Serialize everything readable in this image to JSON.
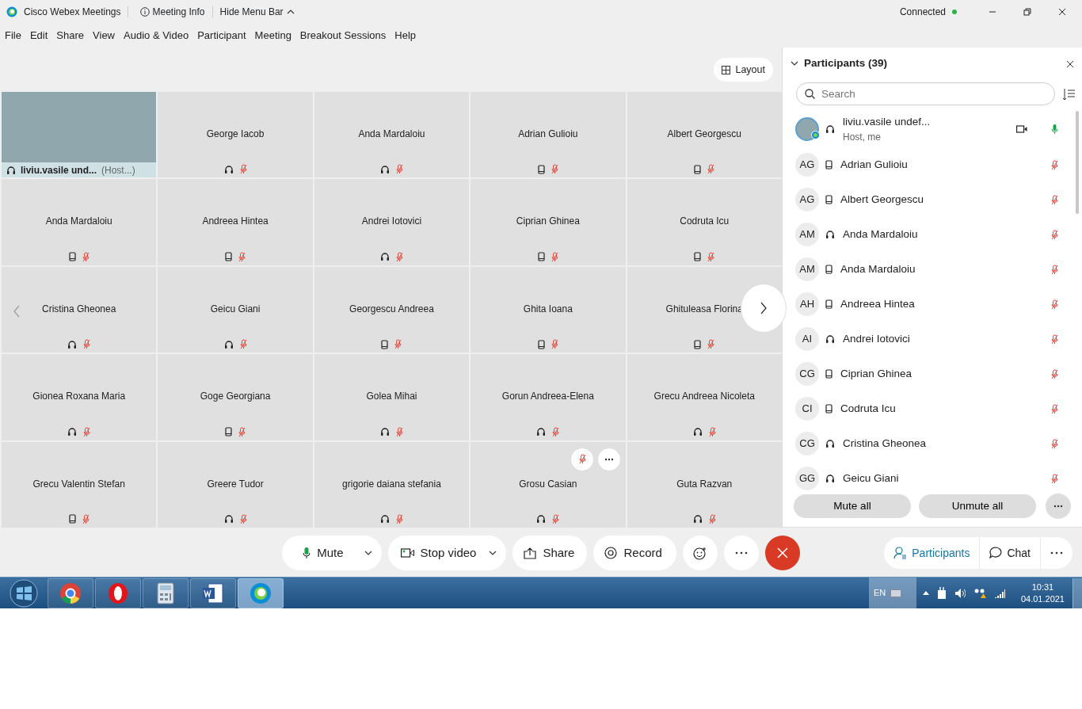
{
  "window": {
    "title": "Cisco Webex Meetings",
    "meeting_info": "Meeting Info",
    "hide_menu": "Hide Menu Bar",
    "status": "Connected"
  },
  "menu": [
    "File",
    "Edit",
    "Share",
    "View",
    "Audio & Video",
    "Participant",
    "Meeting",
    "Breakout Sessions",
    "Help"
  ],
  "layout_button": "Layout",
  "self_view": {
    "name": "liviu.vasile und...",
    "role": "(Host...)"
  },
  "tiles": [
    {
      "kind": "name",
      "name": "George Iacob",
      "phone": false,
      "hovered": false
    },
    {
      "kind": "name",
      "name": "Anda Mardaloiu",
      "phone": false,
      "hovered": false
    },
    {
      "kind": "name",
      "name": "Adrian Gulioiu",
      "phone": true,
      "hovered": false
    },
    {
      "kind": "name",
      "name": "Albert Georgescu",
      "phone": true,
      "hovered": false
    },
    {
      "kind": "name",
      "name": "Anda Mardaloiu",
      "phone": true,
      "hovered": false
    },
    {
      "kind": "name",
      "name": "Andreea Hintea",
      "phone": true,
      "hovered": false
    },
    {
      "kind": "name",
      "name": "Andrei Iotovici",
      "phone": false,
      "hovered": false
    },
    {
      "kind": "name",
      "name": "Ciprian Ghinea",
      "phone": true,
      "hovered": false
    },
    {
      "kind": "name",
      "name": "Codruta Icu",
      "phone": true,
      "hovered": false
    },
    {
      "kind": "name",
      "name": "Cristina Gheonea",
      "phone": false,
      "hovered": false
    },
    {
      "kind": "name",
      "name": "Geicu Giani",
      "phone": false,
      "hovered": false
    },
    {
      "kind": "name",
      "name": "Georgescu Andreea",
      "phone": true,
      "hovered": false
    },
    {
      "kind": "name",
      "name": "Ghita Ioana",
      "phone": true,
      "hovered": false
    },
    {
      "kind": "name",
      "name": "Ghituleasa Florina",
      "phone": true,
      "hovered": false
    },
    {
      "kind": "name",
      "name": "Gionea Roxana Maria",
      "phone": false,
      "hovered": false
    },
    {
      "kind": "name",
      "name": "Goge Georgiana",
      "phone": true,
      "hovered": false
    },
    {
      "kind": "name",
      "name": "Golea Mihai",
      "phone": false,
      "hovered": false
    },
    {
      "kind": "name",
      "name": "Gorun Andreea-Elena",
      "phone": false,
      "hovered": false
    },
    {
      "kind": "name",
      "name": "Grecu Andreea Nicoleta",
      "phone": false,
      "hovered": false
    },
    {
      "kind": "name",
      "name": "Grecu Valentin Stefan",
      "phone": true,
      "hovered": false
    },
    {
      "kind": "name",
      "name": "Greere Tudor",
      "phone": false,
      "hovered": false
    },
    {
      "kind": "name",
      "name": "grigorie daiana stefania",
      "phone": false,
      "hovered": false
    },
    {
      "kind": "name",
      "name": "Grosu Casian",
      "phone": false,
      "hovered": true
    },
    {
      "kind": "name",
      "name": "Guta Razvan",
      "phone": false,
      "hovered": false
    }
  ],
  "panel": {
    "title": "Participants (39)",
    "search": {
      "placeholder": "Search"
    },
    "participants": [
      {
        "kind": "host",
        "name": "liviu.vasile undef...",
        "subtitle": "Host, me",
        "phone": false,
        "muted": false
      },
      {
        "kind": "initials",
        "initials": "AG",
        "name": "Adrian Gulioiu",
        "phone": true,
        "muted": true
      },
      {
        "kind": "initials",
        "initials": "AG",
        "name": "Albert Georgescu",
        "phone": true,
        "muted": true
      },
      {
        "kind": "initials",
        "initials": "AM",
        "name": "Anda Mardaloiu",
        "phone": false,
        "muted": true
      },
      {
        "kind": "initials",
        "initials": "AM",
        "name": "Anda Mardaloiu",
        "phone": true,
        "muted": true
      },
      {
        "kind": "initials",
        "initials": "AH",
        "name": "Andreea Hintea",
        "phone": true,
        "muted": true
      },
      {
        "kind": "initials",
        "initials": "AI",
        "name": "Andrei Iotovici",
        "phone": false,
        "muted": true
      },
      {
        "kind": "initials",
        "initials": "CG",
        "name": "Ciprian Ghinea",
        "phone": true,
        "muted": true
      },
      {
        "kind": "initials",
        "initials": "CI",
        "name": "Codruta Icu",
        "phone": true,
        "muted": true
      },
      {
        "kind": "initials",
        "initials": "CG",
        "name": "Cristina Gheonea",
        "phone": false,
        "muted": true
      },
      {
        "kind": "initials",
        "initials": "GG",
        "name": "Geicu Giani",
        "phone": false,
        "muted": true
      }
    ],
    "buttons": [
      "Mute all",
      "Unmute all"
    ]
  },
  "toolbar": [
    {
      "kind": "mute",
      "label": "Mute"
    },
    {
      "kind": "video",
      "label": "Stop video"
    },
    {
      "kind": "share",
      "label": "Share"
    },
    {
      "kind": "record",
      "label": "Record"
    },
    {
      "kind": "reactions"
    },
    {
      "kind": "more"
    },
    {
      "kind": "leave"
    }
  ],
  "side_tabs": [
    {
      "kind": "participants",
      "label": "Participants",
      "selected": true
    },
    {
      "kind": "chat",
      "label": "Chat",
      "selected": false
    }
  ],
  "taskbar": {
    "apps": [
      {
        "kind": "chrome",
        "selected": false
      },
      {
        "kind": "opera",
        "selected": false
      },
      {
        "kind": "calculator",
        "selected": false
      },
      {
        "kind": "word",
        "selected": false
      },
      {
        "kind": "webex",
        "selected": true
      }
    ],
    "language": "EN",
    "time": "10:31",
    "date": "04.01.2021"
  }
}
